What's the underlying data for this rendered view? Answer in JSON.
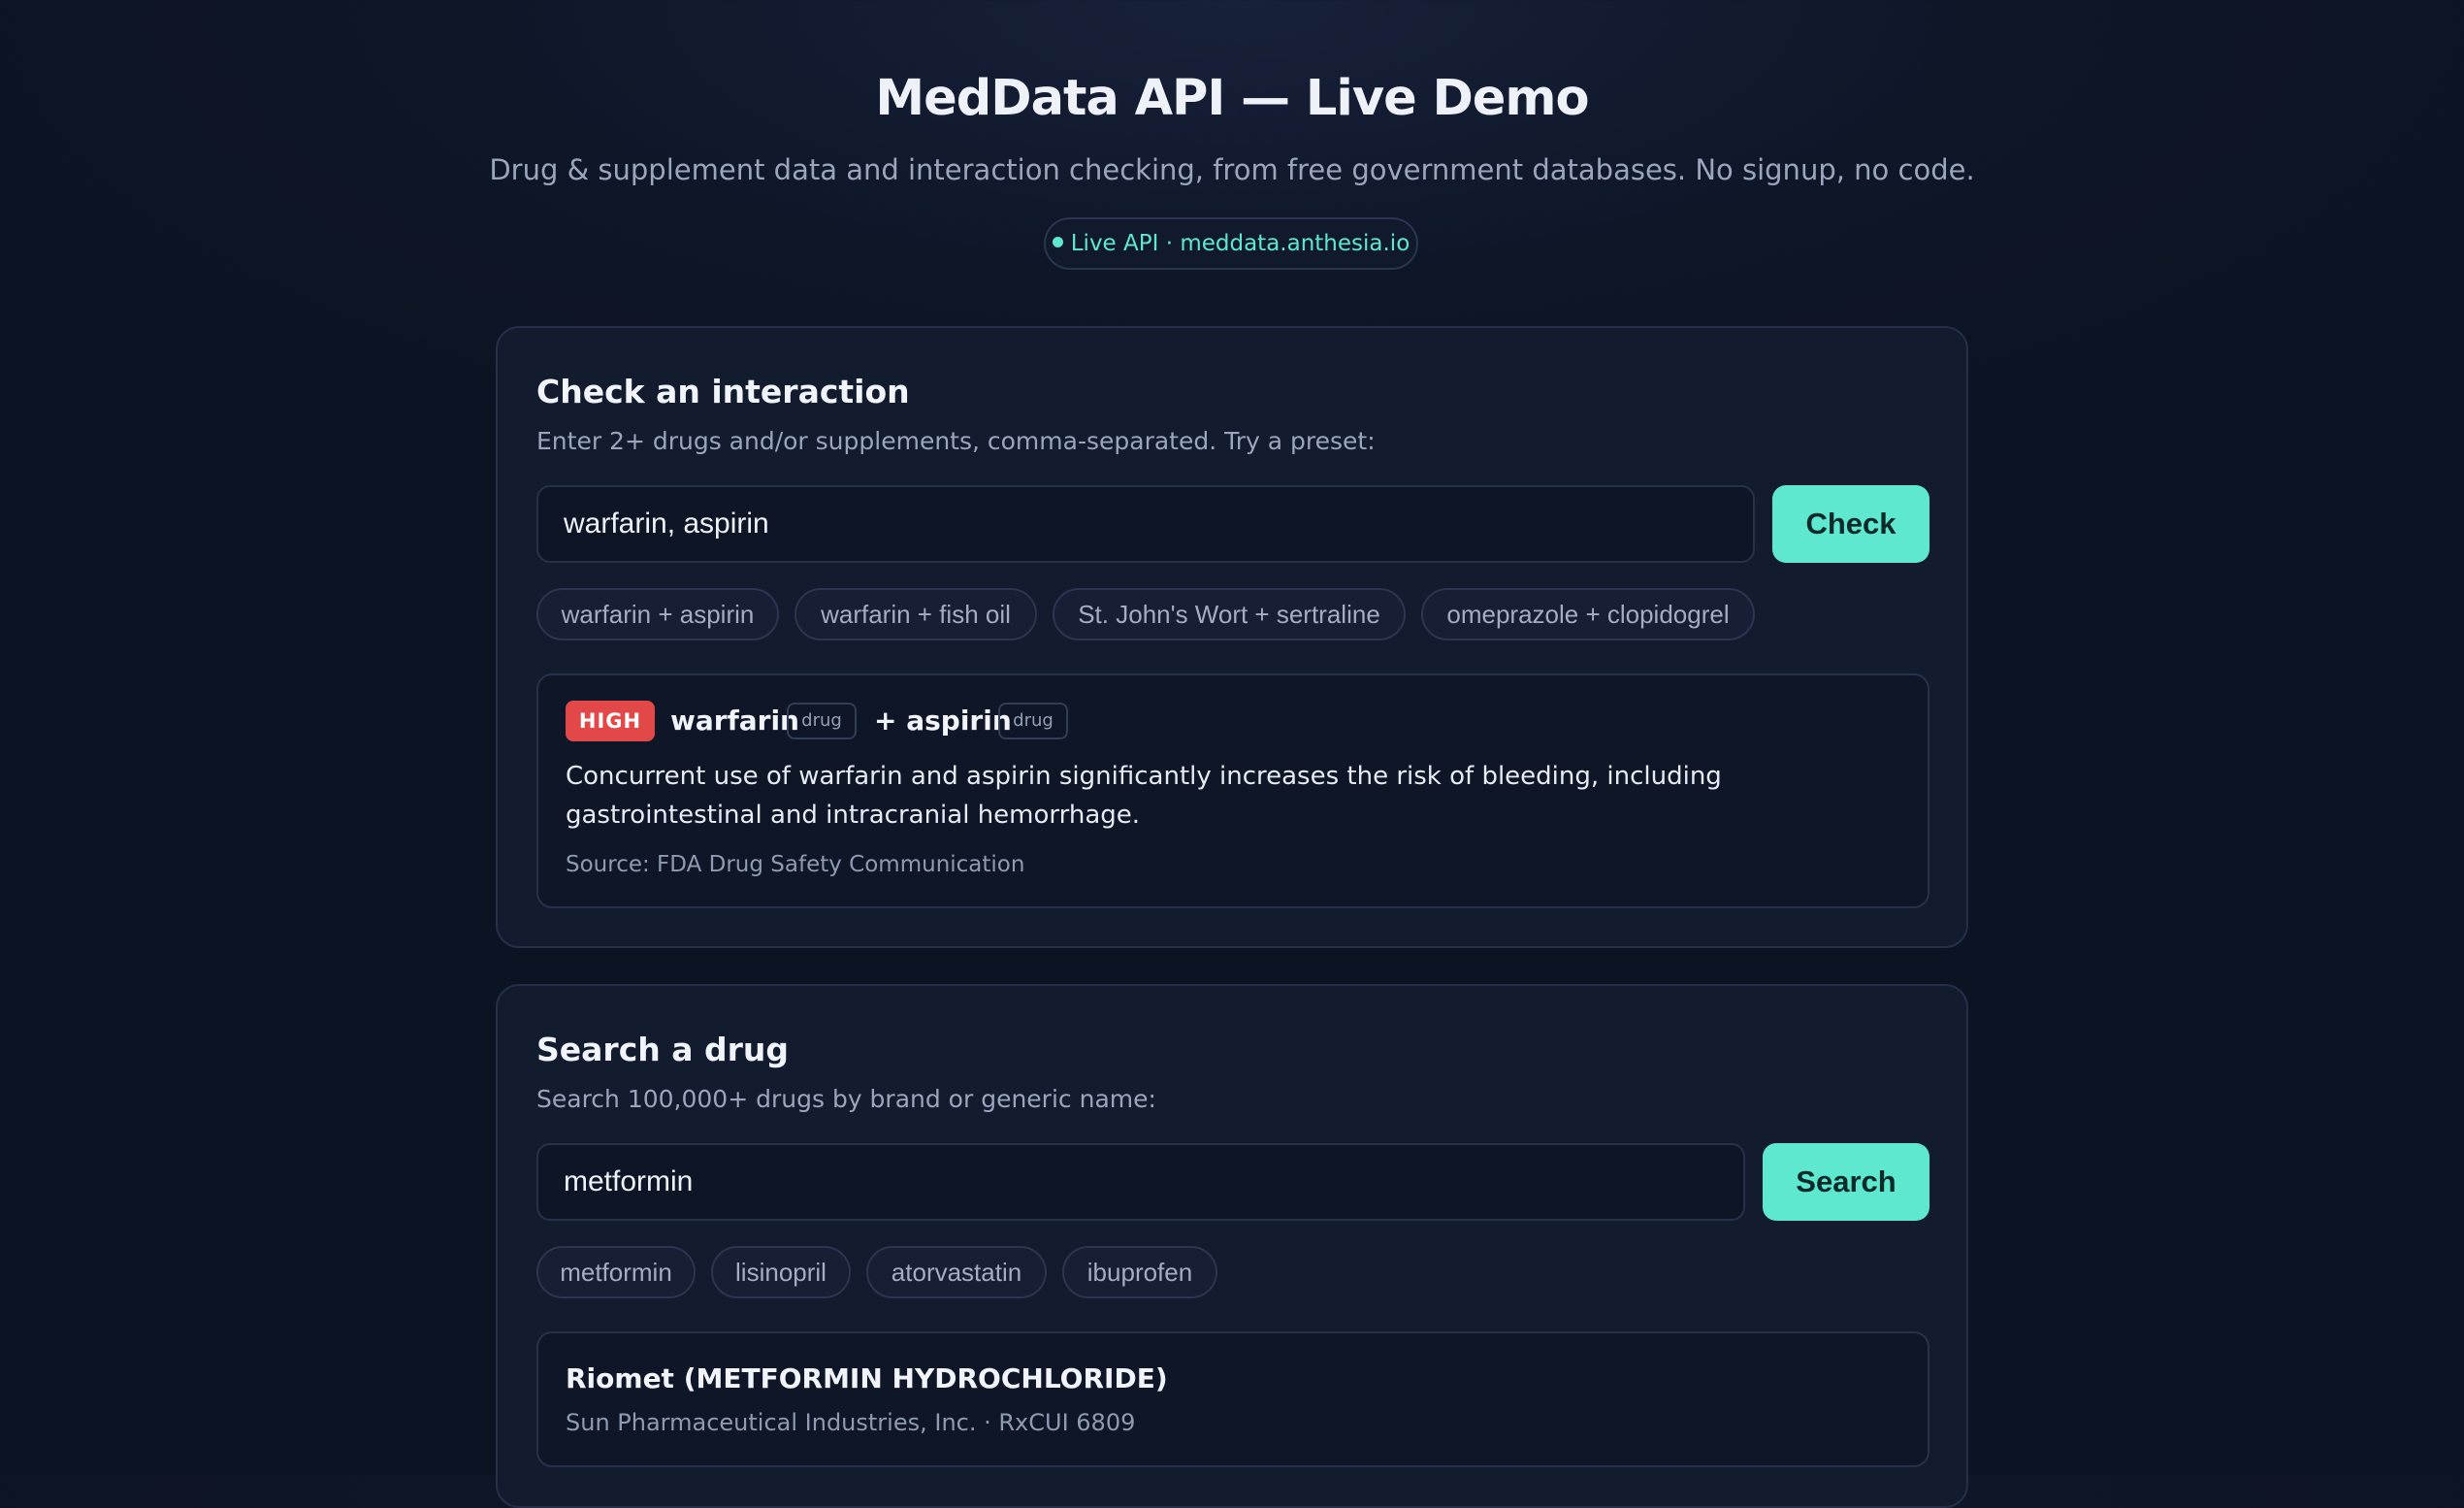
{
  "header": {
    "title": "MedData API — Live Demo",
    "subtitle": "Drug & supplement data and interaction checking, from free government databases. No signup, no code.",
    "live_badge": "Live API · meddata.anthesia.io"
  },
  "interaction": {
    "title": "Check an interaction",
    "description": "Enter 2+ drugs and/or supplements, comma-separated. Try a preset:",
    "input_value": "warfarin, aspirin",
    "button_label": "Check",
    "presets": [
      "warfarin + aspirin",
      "warfarin + fish oil",
      "St. John's Wort + sertraline",
      "omeprazole + clopidogrel"
    ],
    "result": {
      "severity": "HIGH",
      "drug_a": "warfarin",
      "drug_a_type": "drug",
      "drug_b": "+ aspirin",
      "drug_b_type": "drug",
      "description": "Concurrent use of warfarin and aspirin significantly increases the risk of bleeding, including gastrointestinal and intracranial hemorrhage.",
      "source": "Source: FDA Drug Safety Communication"
    }
  },
  "search": {
    "title": "Search a drug",
    "description": "Search 100,000+ drugs by brand or generic name:",
    "input_value": "metformin",
    "button_label": "Search",
    "presets": [
      "metformin",
      "lisinopril",
      "atorvastatin",
      "ibuprofen"
    ],
    "results": [
      {
        "title": "Riomet (METFORMIN HYDROCHLORIDE)",
        "meta": "Sun Pharmaceutical Industries, Inc. · RxCUI 6809"
      }
    ]
  },
  "colors": {
    "accent": "#5fe8d0",
    "severity_high": "#e24848",
    "background": "#0f1628",
    "card": "#131b2e"
  }
}
